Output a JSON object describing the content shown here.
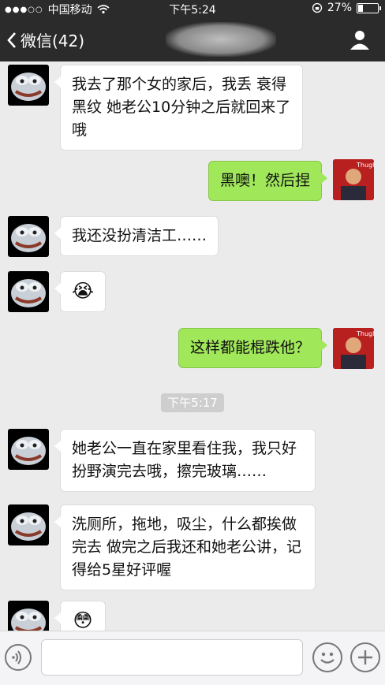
{
  "status_bar": {
    "carrier": "中国移动",
    "time": "下午5:24",
    "battery_percent": "27%",
    "battery_level": 0.27
  },
  "nav": {
    "back_label": "微信(42)"
  },
  "messages": [
    {
      "side": "in",
      "text": "我去了那个女的家后，我丢 衰得黑纹 她老公10分钟之后就回来了哦"
    },
    {
      "side": "out",
      "text": "黑噢！然后捏"
    },
    {
      "side": "in",
      "text": "我还没扮清洁工……"
    },
    {
      "side": "in",
      "emoji": "😭"
    },
    {
      "side": "out",
      "text": "这样都能棍跌他？"
    },
    {
      "timestamp": "下午5:17"
    },
    {
      "side": "in",
      "text": "她老公一直在家里看住我，我只好扮野演完去哦，擦完玻璃……"
    },
    {
      "side": "in",
      "text": "洗厕所，拖地，吸尘，什么都挨做完去 做完之后我还和她老公讲，记得给5星好评喔"
    },
    {
      "side": "in",
      "emoji": "😳"
    }
  ],
  "colors": {
    "nav_bg": "#2b2b2b",
    "chat_bg": "#ebebeb",
    "out_bubble": "#a0e75a",
    "in_bubble": "#ffffff"
  }
}
